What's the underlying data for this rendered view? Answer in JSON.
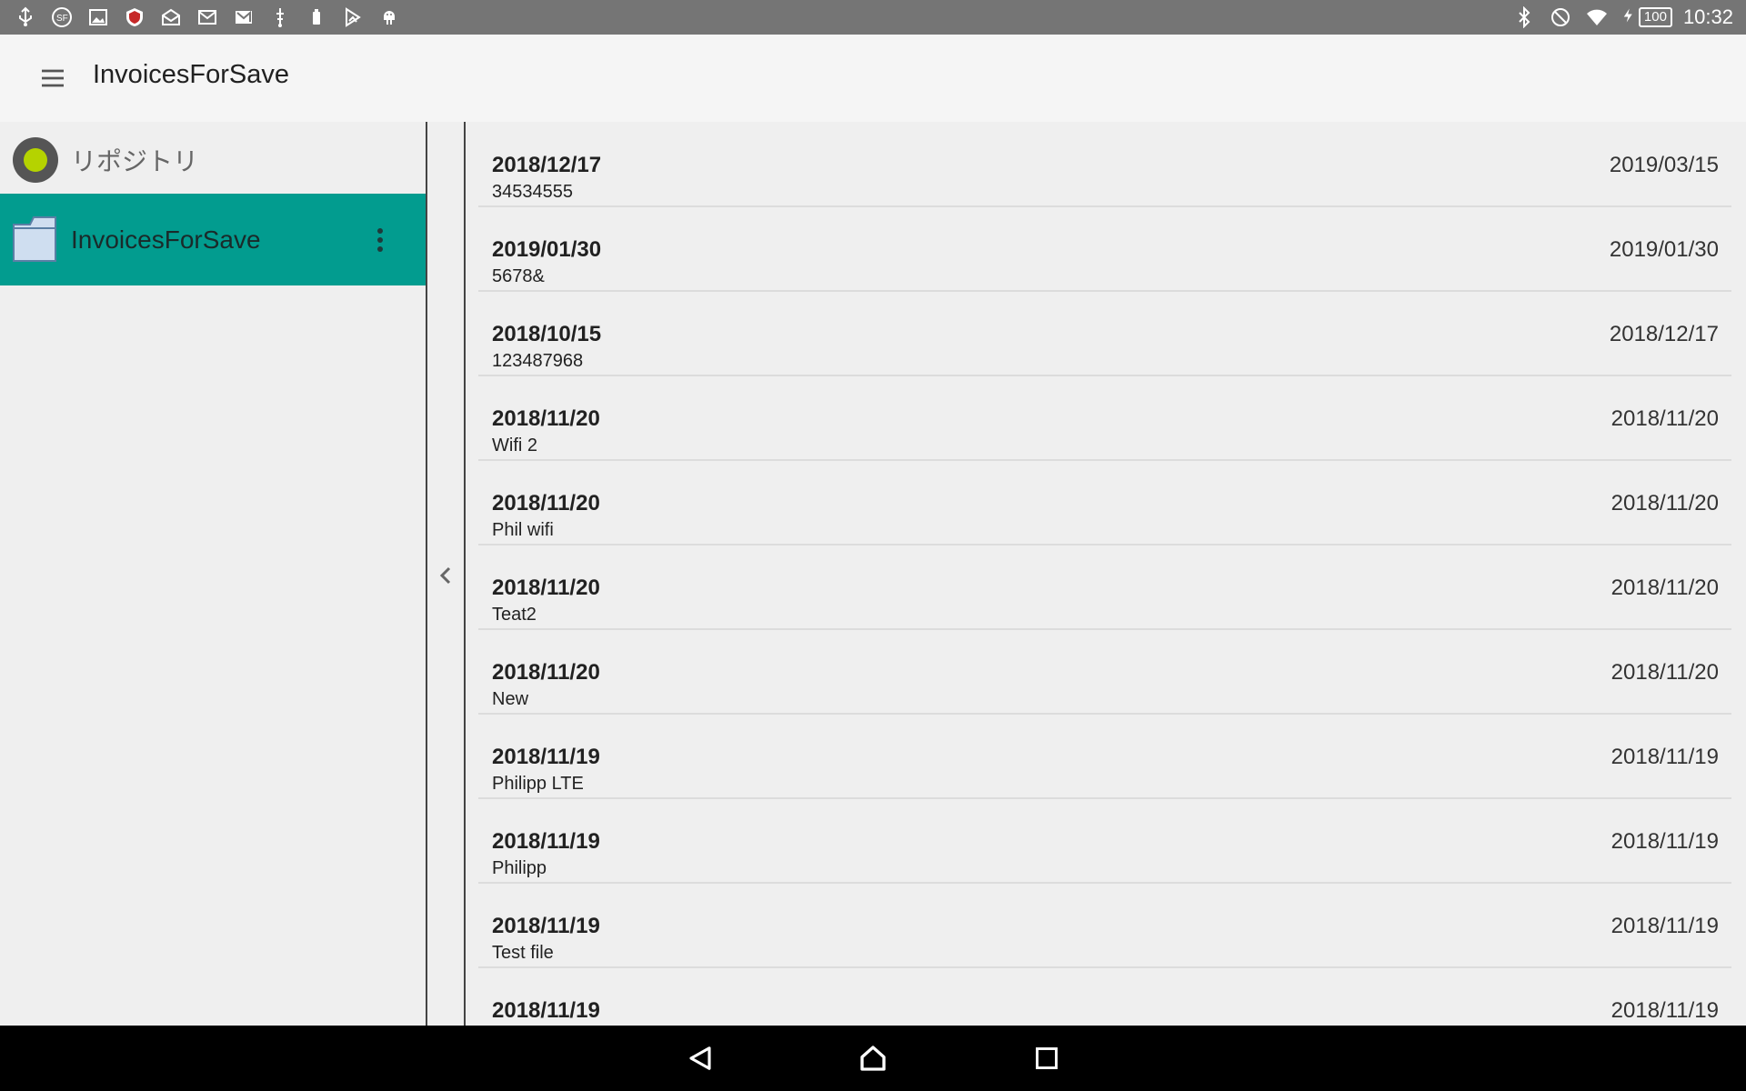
{
  "status_bar": {
    "left_icons": [
      "usb-icon",
      "sf-icon",
      "image-icon",
      "mcafee-icon",
      "mail-open-icon",
      "email-icon",
      "gmail-icon",
      "usb-debug-icon",
      "device-icon",
      "play-store-icon",
      "android-icon"
    ],
    "right_icons": [
      "bluetooth-icon",
      "do-not-disturb-icon",
      "wifi-icon",
      "charging-icon"
    ],
    "battery": "100",
    "time": "10:32"
  },
  "app_bar": {
    "title": "InvoicesForSave"
  },
  "sidebar": {
    "header_label": "リポジトリ",
    "accent_color": "#029c8f",
    "items": [
      {
        "label": "InvoicesForSave",
        "selected": true
      }
    ]
  },
  "list": {
    "rows": [
      {
        "title": "2018/12/17",
        "subtitle": "34534555",
        "date": "2019/03/15"
      },
      {
        "title": "2019/01/30",
        "subtitle": "5678&",
        "date": "2019/01/30"
      },
      {
        "title": "2018/10/15",
        "subtitle": "123487968",
        "date": "2018/12/17"
      },
      {
        "title": "2018/11/20",
        "subtitle": "Wifi 2",
        "date": "2018/11/20"
      },
      {
        "title": "2018/11/20",
        "subtitle": "Phil wifi",
        "date": "2018/11/20"
      },
      {
        "title": "2018/11/20",
        "subtitle": "Teat2",
        "date": "2018/11/20"
      },
      {
        "title": "2018/11/20",
        "subtitle": "New",
        "date": "2018/11/20"
      },
      {
        "title": "2018/11/19",
        "subtitle": "Philipp LTE",
        "date": "2018/11/19"
      },
      {
        "title": "2018/11/19",
        "subtitle": "Philipp",
        "date": "2018/11/19"
      },
      {
        "title": "2018/11/19",
        "subtitle": "Test file",
        "date": "2018/11/19"
      },
      {
        "title": "2018/11/19",
        "subtitle": "",
        "date": "2018/11/19"
      }
    ]
  },
  "nav_bar": {
    "buttons": [
      "back-icon",
      "home-icon",
      "recents-icon"
    ]
  }
}
